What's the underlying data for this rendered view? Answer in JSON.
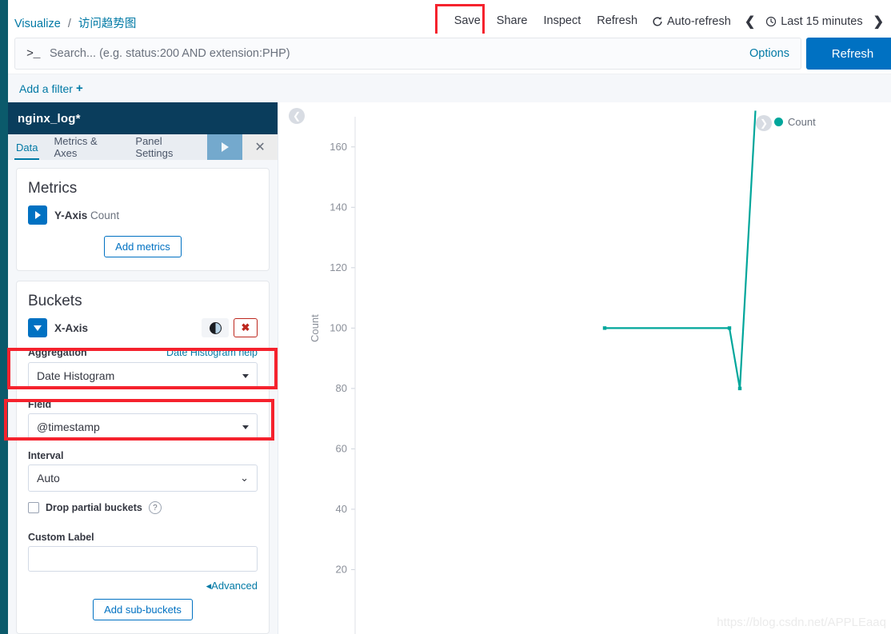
{
  "breadcrumb": {
    "root": "Visualize",
    "separator": "/",
    "current": "访问趋势图"
  },
  "top_actions": {
    "save": "Save",
    "share": "Share",
    "inspect": "Inspect",
    "refresh": "Refresh",
    "auto_refresh": "Auto-refresh",
    "auto_refresh_icon": "refresh-cycle-icon",
    "prev_icon": "chevron-left-icon",
    "next_icon": "chevron-right-icon",
    "clock_icon": "clock-icon",
    "time_range": "Last 15 minutes"
  },
  "query_bar": {
    "prompt_glyph": ">_",
    "placeholder": "Search... (e.g. status:200 AND extension:PHP)",
    "value": "",
    "options_label": "Options",
    "refresh_label": "Refresh"
  },
  "filter_bar": {
    "add_filter_label": "Add a filter",
    "plus_icon": "+"
  },
  "sidebar": {
    "index_pattern": "nginx_log*",
    "tabs": [
      {
        "label": "Data",
        "active": true
      },
      {
        "label": "Metrics & Axes",
        "active": false
      },
      {
        "label": "Panel Settings",
        "active": false
      }
    ],
    "apply_icon": "play-icon",
    "close_icon": "×",
    "metrics": {
      "title": "Metrics",
      "expand_icon": "caret-right-icon",
      "axis_label": "Y-Axis",
      "axis_value": "Count",
      "add_metrics_label": "Add metrics"
    },
    "buckets": {
      "title": "Buckets",
      "collapse_icon": "caret-down-icon",
      "axis_label": "X-Axis",
      "toggle_icon": "contrast-toggle-icon",
      "delete_icon": "✖",
      "aggregation_label": "Aggregation",
      "aggregation_help": "Date Histogram help",
      "aggregation_value": "Date Histogram",
      "field_label": "Field",
      "field_value": "@timestamp",
      "interval_label": "Interval",
      "interval_value": "Auto",
      "drop_partial_label": "Drop partial buckets",
      "drop_partial_checked": false,
      "help_icon": "?",
      "custom_label_label": "Custom Label",
      "custom_label_value": "",
      "advanced_label": "Advanced",
      "advanced_icon": "caret-left-icon",
      "add_sub_buckets_label": "Add sub-buckets"
    }
  },
  "chart_panel": {
    "collapse_left_icon": "chevron-left-circle-icon",
    "collapse_right_icon": "chevron-right-circle-icon",
    "legend_label": "Count",
    "legend_color": "#00a69b",
    "watermark": "https://blog.csdn.net/APPLEaaq"
  },
  "chart_data": {
    "type": "line",
    "title": "",
    "xlabel": "",
    "ylabel": "Count",
    "ylim": [
      0,
      170
    ],
    "yticks": [
      20,
      40,
      60,
      80,
      100,
      120,
      140,
      160
    ],
    "grid": false,
    "legend_position": "top-right",
    "line_color": "#00a69b",
    "series": [
      {
        "name": "Count",
        "points": [
          {
            "x": 0.48,
            "y": 100
          },
          {
            "x": 0.72,
            "y": 100
          },
          {
            "x": 0.74,
            "y": 80
          },
          {
            "x": 0.77,
            "y": 172
          }
        ]
      }
    ]
  }
}
